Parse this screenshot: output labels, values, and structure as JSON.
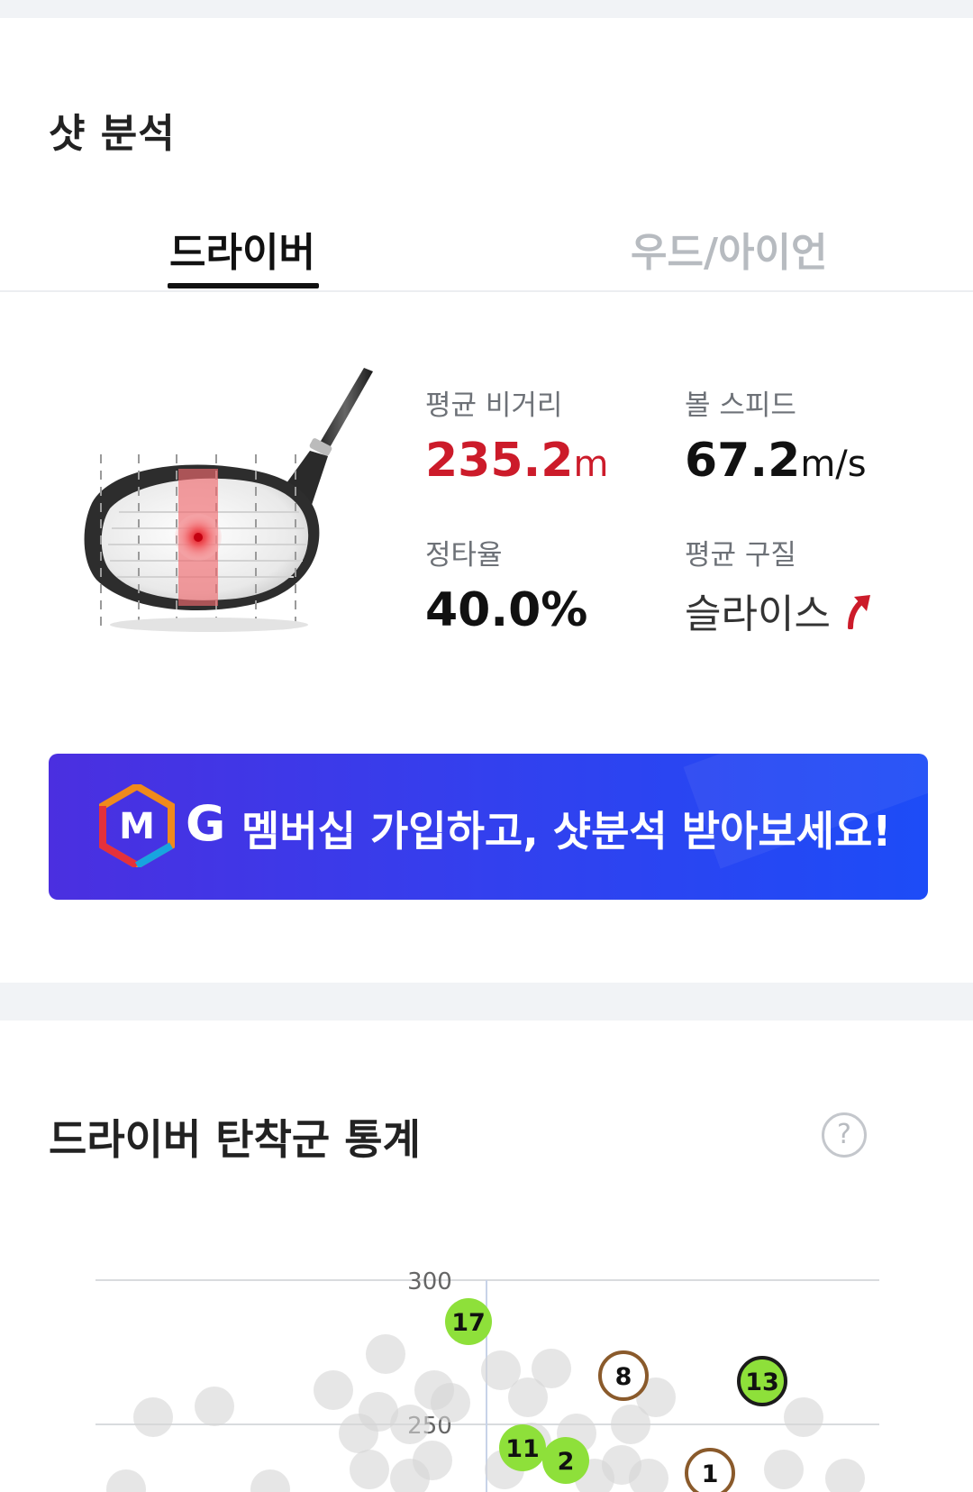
{
  "section_title": "샷 분석",
  "tabs": [
    {
      "label": "드라이버",
      "active": true
    },
    {
      "label": "우드/아이언",
      "active": false
    }
  ],
  "stats": {
    "avg_distance": {
      "label": "평균 비거리",
      "value": "235.2",
      "unit": "m"
    },
    "ball_speed": {
      "label": "볼 스피드",
      "value": "67.2",
      "unit": "m/s"
    },
    "accuracy": {
      "label": "정타율",
      "value": "40.0%"
    },
    "avg_ball_flight": {
      "label": "평균 구질",
      "value": "슬라이스",
      "icon": "slice-arrow-icon"
    }
  },
  "banner": {
    "logo_letter": "M",
    "g_letter": "G",
    "text": "멤버십 가입하고, 샷분석 받아보세요!"
  },
  "landing_stats": {
    "title": "드라이버 탄착군 통계",
    "help_symbol": "?"
  },
  "colors": {
    "accent_red": "#cc1b2a",
    "banner_start": "#4b2fe0",
    "banner_end": "#1d4cf7",
    "marker_green": "#8ee03a",
    "marker_brown": "#8a5a2b",
    "scatter_gray": "#d8d8d8"
  },
  "chart_data": {
    "type": "scatter",
    "y_ticks": [
      "300",
      "250"
    ],
    "labeled_points": [
      {
        "label": "17",
        "style": "green"
      },
      {
        "label": "8",
        "style": "brown-ring"
      },
      {
        "label": "13",
        "style": "green-ring"
      },
      {
        "label": "11",
        "style": "green"
      },
      {
        "label": "2",
        "style": "green"
      },
      {
        "label": "1",
        "style": "brown-ring"
      }
    ]
  }
}
